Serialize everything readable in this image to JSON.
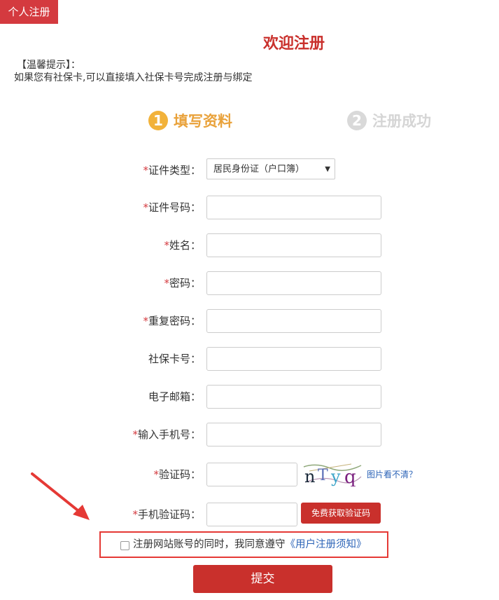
{
  "header": {
    "tab_label": "个人注册"
  },
  "title": "欢迎注册",
  "tip": {
    "title": "【温馨提示】：",
    "text": "如果您有社保卡,可以直接填入社保卡号完成注册与绑定"
  },
  "steps": [
    {
      "num": "1",
      "label": "填写资料"
    },
    {
      "num": "2",
      "label": "注册成功"
    }
  ],
  "form": {
    "id_type": {
      "label": "证件类型：",
      "value": "居民身份证（户口簿）",
      "required": true
    },
    "id_number": {
      "label": "证件号码：",
      "value": "",
      "required": true
    },
    "name": {
      "label": "姓名：",
      "value": "",
      "required": true
    },
    "password": {
      "label": "密码：",
      "value": "",
      "required": true
    },
    "repeat_password": {
      "label": "重复密码：",
      "value": "",
      "required": true
    },
    "social_card": {
      "label": "社保卡号：",
      "value": "",
      "required": false
    },
    "email": {
      "label": "电子邮箱：",
      "value": "",
      "required": false
    },
    "phone": {
      "label": "输入手机号：",
      "value": "",
      "required": true
    },
    "captcha": {
      "label": "验证码：",
      "value": "",
      "required": true,
      "image_text": "nTyq",
      "help": "图片看不清？"
    },
    "sms_code": {
      "label": "手机验证码：",
      "value": "",
      "required": true,
      "button": "免费获取验证码"
    }
  },
  "agreement": {
    "text": "注册网站账号的同时，我同意遵守",
    "link": "《用户注册须知》"
  },
  "submit_label": "提交",
  "required_mark": "*",
  "colors": {
    "brand_red": "#c9302c",
    "step_active": "#e9a23b",
    "step_inactive": "#d5d5d5",
    "link": "#2b63b7"
  }
}
